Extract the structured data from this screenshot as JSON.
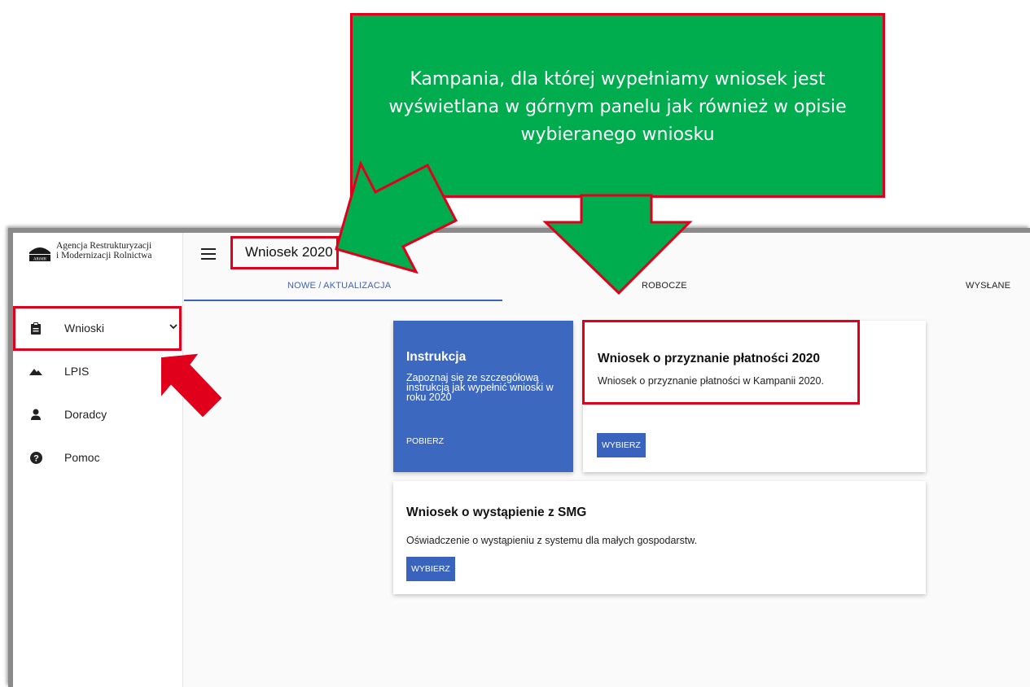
{
  "callout": {
    "text": "Kampania, dla której wypełniamy wniosek jest wyświetlana w górnym panelu jak również w opisie wybieranego wniosku"
  },
  "logo": {
    "line1": "Agencja Restrukturyzacji",
    "line2": "i Modernizacji Rolnictwa",
    "abbr": "ARiMR"
  },
  "sidebar": {
    "items": [
      {
        "label": "Wnioski",
        "icon": "clipboard-icon"
      },
      {
        "label": "LPIS",
        "icon": "mountains-icon"
      },
      {
        "label": "Doradcy",
        "icon": "person-icon"
      },
      {
        "label": "Pomoc",
        "icon": "help-icon"
      }
    ]
  },
  "header": {
    "title": "Wniosek 2020",
    "tabs": [
      {
        "label": "NOWE / AKTUALIZACJA",
        "active": true
      },
      {
        "label": "ROBOCZE",
        "active": false
      },
      {
        "label": "WYSŁANE",
        "active": false
      }
    ]
  },
  "instruction": {
    "title": "Instrukcja",
    "text": "Zapoznaj się ze szczegółową instrukcją jak wypełnić wnioski w roku 2020",
    "download_label": "POBIERZ"
  },
  "cards": [
    {
      "title": "Wniosek o przyznanie płatności 2020",
      "text": "Wniosek o przyznanie płatności w Kampanii 2020.",
      "button_label": "WYBIERZ"
    },
    {
      "title": "Wniosek o wystąpienie z SMG",
      "text": "Oświadczenie o wystąpieniu z systemu dla małych gospodarstw.",
      "button_label": "WYBIERZ"
    }
  ],
  "colors": {
    "accent": "#3a63bd",
    "callout_green": "#00ad4e",
    "annotation_red": "#e0001b"
  }
}
